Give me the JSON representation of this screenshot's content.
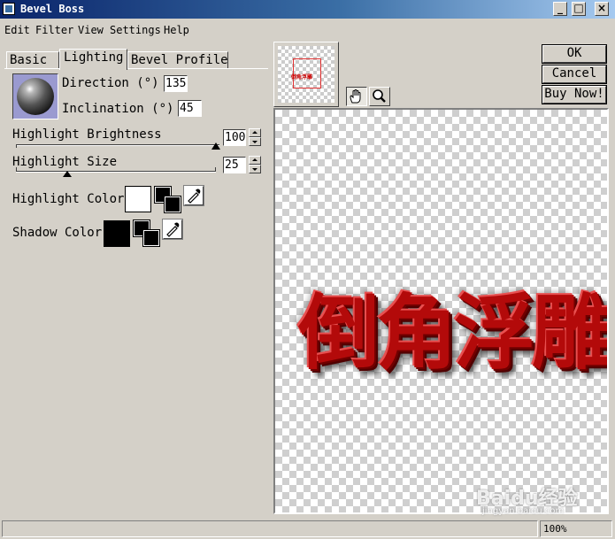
{
  "window": {
    "title": "Bevel Boss"
  },
  "menu": [
    "Edit",
    "Filter",
    "View",
    "Settings",
    "Help"
  ],
  "tabs": [
    {
      "label": "Basic",
      "active": false
    },
    {
      "label": "Lighting",
      "active": true
    },
    {
      "label": "Bevel Profile",
      "active": false
    }
  ],
  "lighting": {
    "direction_label": "Direction (°)",
    "direction_value": "135",
    "inclination_label": "Inclination (°)",
    "inclination_value": "45",
    "highlight_brightness_label": "Highlight Brightness",
    "highlight_brightness_value": "100",
    "highlight_size_label": "Highlight Size",
    "highlight_size_value": "25",
    "highlight_color_label": "Highlight Color",
    "highlight_color": "#ffffff",
    "shadow_color_label": "Shadow Color",
    "shadow_color": "#000000"
  },
  "preview": {
    "thumbnail_text": "倒角浮雕",
    "text": "倒角浮雕"
  },
  "buttons": {
    "ok": "OK",
    "cancel": "Cancel",
    "buy": "Buy Now!"
  },
  "status": {
    "zoom": "100%"
  },
  "watermark": {
    "brand": "Baidu经验",
    "url": "jingyan.baidu.com"
  },
  "colors": {
    "title_start": "#0a246a",
    "title_end": "#a6caf0",
    "face": "#d4d0c8",
    "text_red": "#b30a0a"
  }
}
